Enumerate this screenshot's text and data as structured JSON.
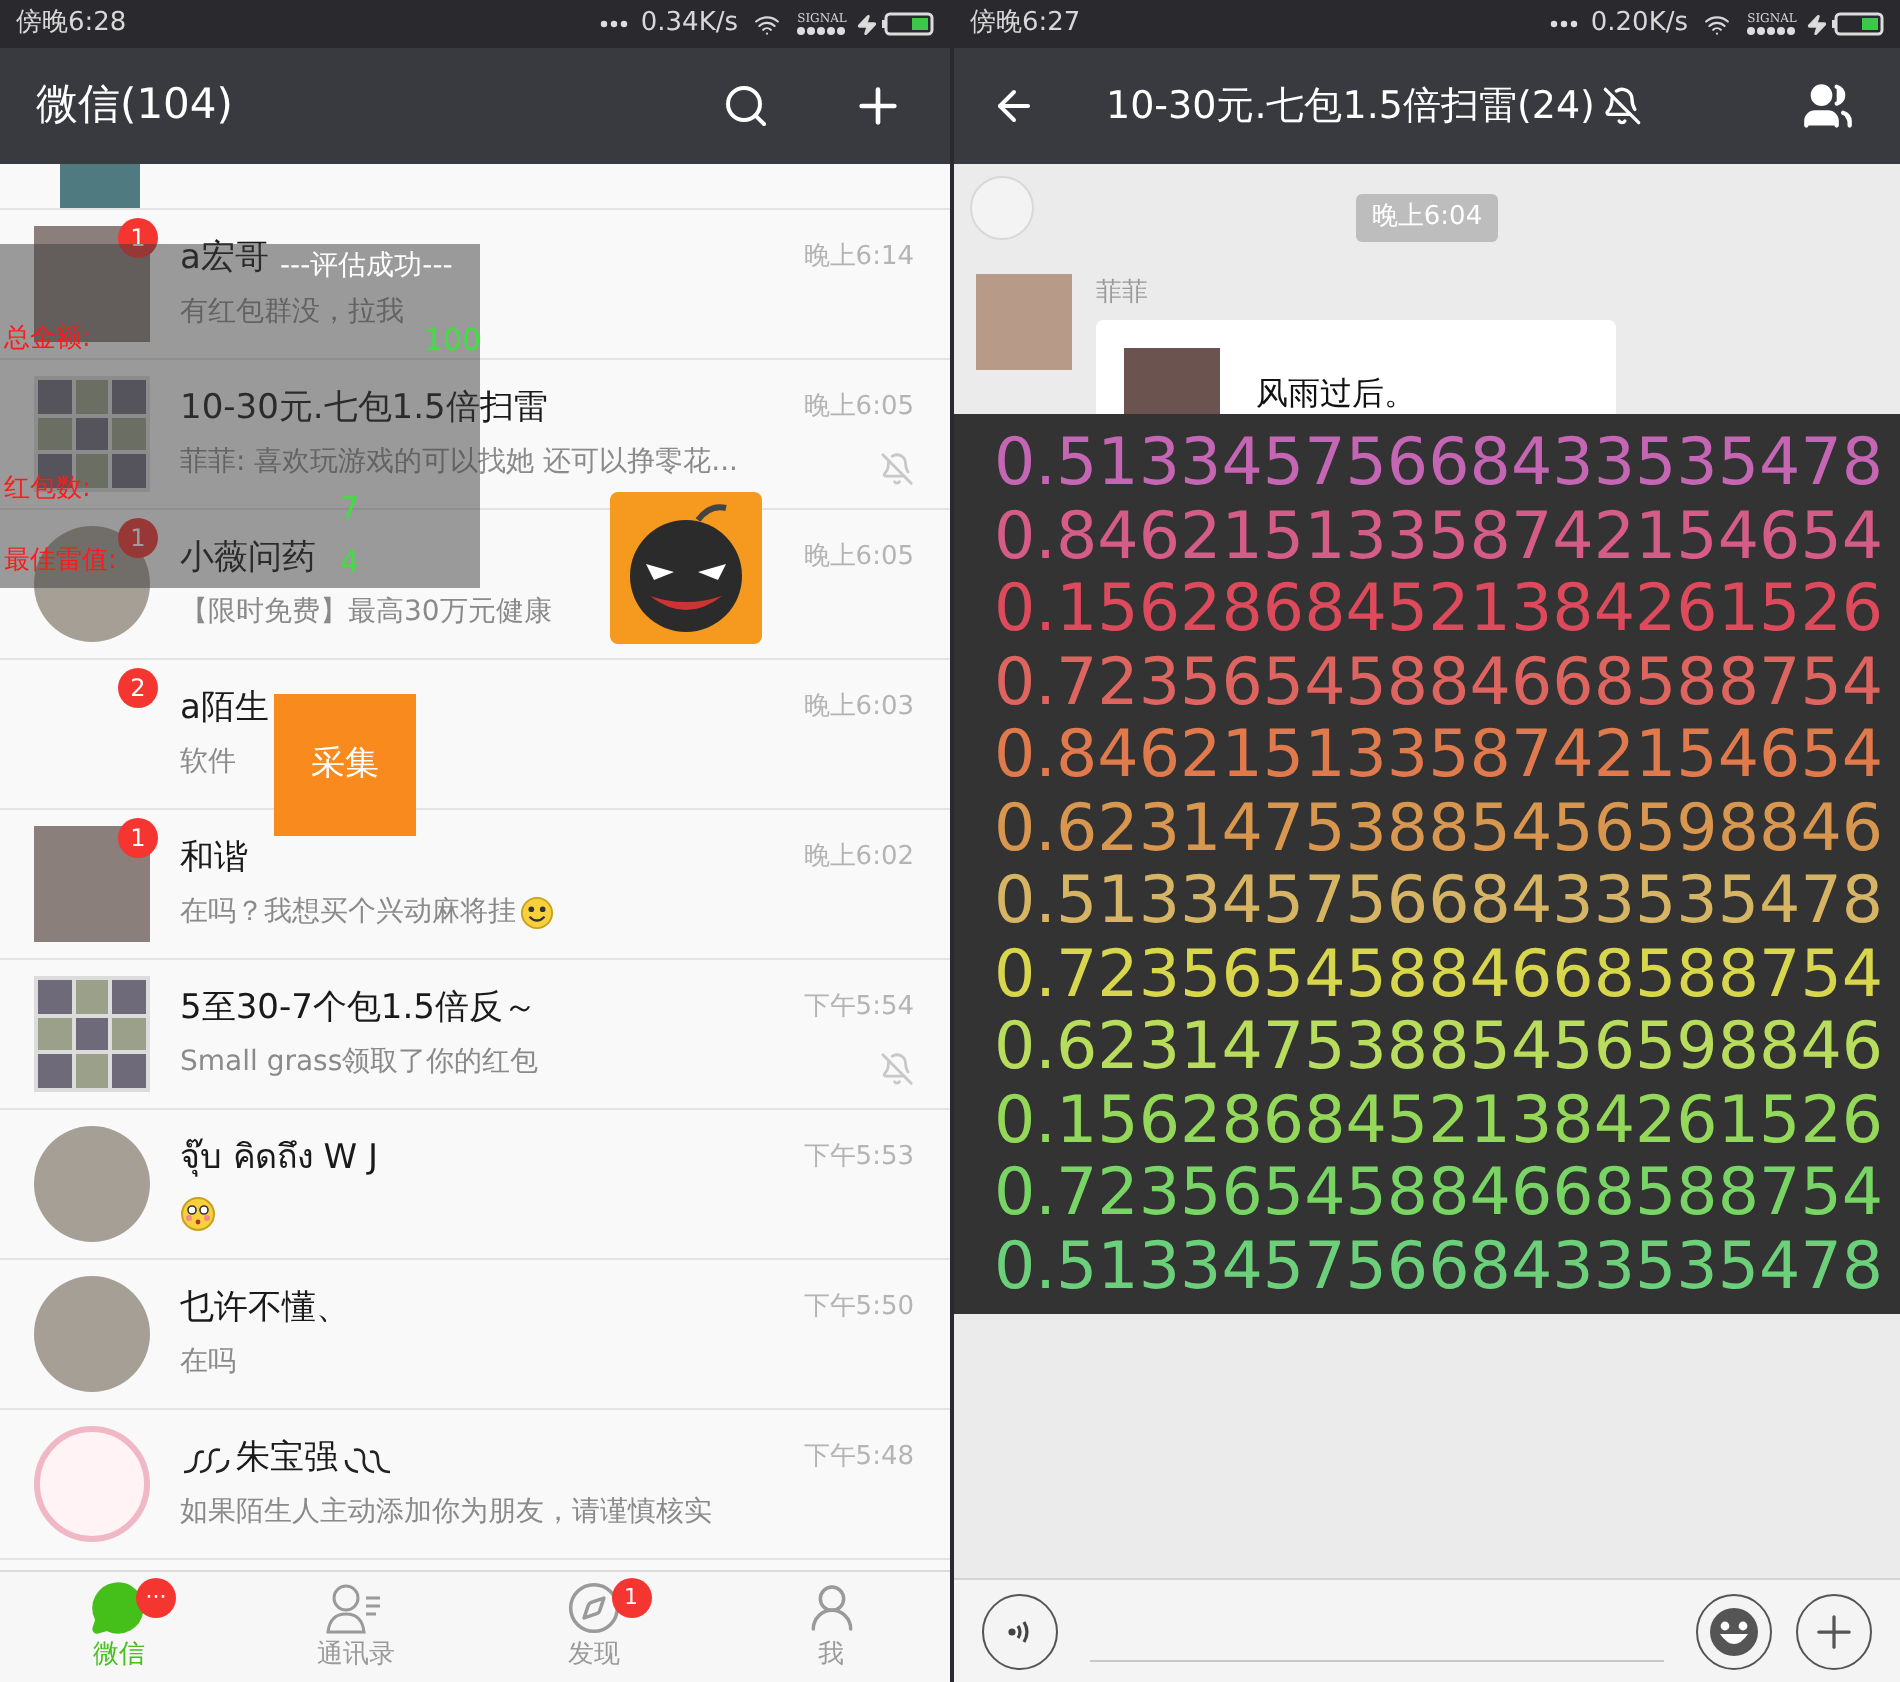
{
  "left": {
    "status_bar": {
      "time": "傍晚6:28",
      "speed": "0.34K/s",
      "signal_label": "SIGNAL"
    },
    "header": {
      "title": "微信(104)"
    },
    "chats": [
      {
        "name": "a宏哥",
        "preview": "有红包群没，拉我",
        "time": "晚上6:14",
        "badge": "1",
        "muted": false,
        "avatar": {
          "kind": "photo"
        }
      },
      {
        "name": "10-30元.七包1.5倍扫雷",
        "preview": "菲菲: 喜欢玩游戏的可以找她 还可以挣零花...",
        "time": "晚上6:05",
        "muted": true,
        "avatar": {
          "kind": "grid"
        }
      },
      {
        "name": "小薇问药",
        "preview": "【限时免费】最高30万元健康",
        "time": "晚上6:05",
        "badge": "1",
        "muted": false,
        "avatar": {
          "kind": "round"
        }
      },
      {
        "name": "a陌生",
        "preview": "软件",
        "time": "晚上6:03",
        "badge": "2",
        "muted": false,
        "avatar": {
          "kind": "none"
        }
      },
      {
        "name": "和谐",
        "preview": "在吗？我想买个兴动麻将挂",
        "emoji": {
          "kind": "smile"
        },
        "time": "晚上6:02",
        "badge": "1",
        "muted": false,
        "avatar": {
          "kind": "photo"
        }
      },
      {
        "name": "5至30-7个包1.5倍反～",
        "preview": "Small grass领取了你的红包",
        "time": "下午5:54",
        "muted": true,
        "avatar": {
          "kind": "grid"
        }
      },
      {
        "name": "จุ๊บ คิดถึง W J",
        "emoji": {
          "kind": "flushed"
        },
        "time": "下午5:53",
        "muted": false,
        "avatar": {
          "kind": "round"
        }
      },
      {
        "name": "乜许不懂、",
        "preview": "在吗",
        "time": "下午5:50",
        "muted": false,
        "avatar": {
          "kind": "round"
        }
      },
      {
        "name": "朱宝强",
        "flourish": true,
        "preview": "如果陌生人主动添加你为朋友，请谨慎核实",
        "time": "下午5:48",
        "muted": false,
        "avatar": {
          "kind": "outline"
        }
      }
    ],
    "overlay": {
      "title": "---评估成功---",
      "rows": [
        {
          "label": "总金额:",
          "value": "100"
        },
        {
          "label": "红包数:",
          "value": "7"
        },
        {
          "label": "最佳雷值:",
          "value": "4"
        }
      ]
    },
    "collect_button": "采集",
    "tabs": [
      {
        "label": "微信",
        "selected": true,
        "badge": "···"
      },
      {
        "label": "通讯录",
        "selected": false
      },
      {
        "label": "发现",
        "selected": false,
        "badge": "1"
      },
      {
        "label": "我",
        "selected": false
      }
    ]
  },
  "right": {
    "status_bar": {
      "time": "傍晚6:27",
      "speed": "0.20K/s",
      "signal_label": "SIGNAL"
    },
    "header": {
      "title": "10-30元.七包1.5倍扫雷(24)",
      "muted": true
    },
    "time_stamp": "晚上6:04",
    "message": {
      "sender": "菲菲",
      "text": "风雨过后。"
    },
    "numbers": [
      {
        "text": "0.51334575668433535478",
        "color": "#c466b4"
      },
      {
        "text": "0.84621513358742154654",
        "color": "#d65c88"
      },
      {
        "text": "0.15628684521384261526",
        "color": "#dc4a5c"
      },
      {
        "text": "0.72356545884668588754",
        "color": "#de6460"
      },
      {
        "text": "0.84621513358742154654",
        "color": "#e07a4c"
      },
      {
        "text": "0.62314753885456598846",
        "color": "#d8964e"
      },
      {
        "text": "0.51334575668433535478",
        "color": "#d6b464"
      },
      {
        "text": "0.72356545884668588754",
        "color": "#d8d64c"
      },
      {
        "text": "0.62314753885456598846",
        "color": "#b8dc5c"
      },
      {
        "text": "0.15628684521384261526",
        "color": "#94d85a"
      },
      {
        "text": "0.72356545884668588754",
        "color": "#78d464"
      },
      {
        "text": "0.51334575668433535478",
        "color": "#6cd07a"
      }
    ]
  }
}
